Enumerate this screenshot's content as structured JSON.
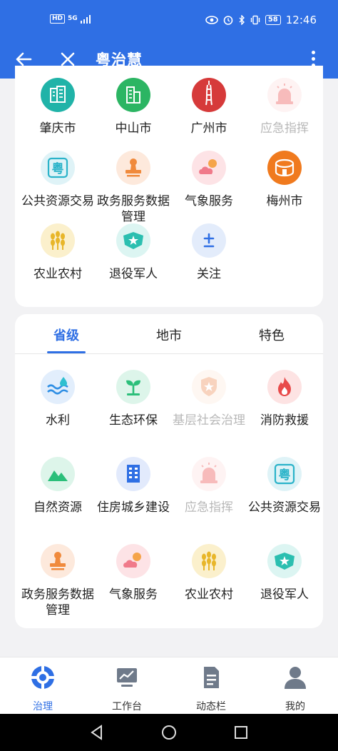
{
  "statusbar": {
    "left_badge": "HD",
    "network": "5G",
    "battery": "58",
    "time": "12:46"
  },
  "appbar": {
    "title": "粤治慧"
  },
  "top_card": {
    "items": [
      {
        "label": "肇庆市",
        "icon": "building-icon",
        "color": "#20b3a8",
        "disabled": false
      },
      {
        "label": "中山市",
        "icon": "tower-building-icon",
        "color": "#2cb563",
        "disabled": false
      },
      {
        "label": "广州市",
        "icon": "canton-tower-icon",
        "color": "#d63a3a",
        "disabled": false
      },
      {
        "label": "应急指挥",
        "icon": "siren-icon",
        "color": "#ef6a6a",
        "disabled": true
      },
      {
        "label": "公共资源交易",
        "icon": "yue-badge-icon",
        "color": "#2bb3c9",
        "disabled": false
      },
      {
        "label": "政务服务数据管理",
        "icon": "stamp-icon",
        "color": "#f08a3c",
        "disabled": false
      },
      {
        "label": "气象服务",
        "icon": "weather-icon",
        "color": "#f07a8a",
        "disabled": false
      },
      {
        "label": "梅州市",
        "icon": "tulou-icon",
        "color": "#f07a1e",
        "disabled": false
      },
      {
        "label": "农业农村",
        "icon": "wheat-icon",
        "color": "#e8b62a",
        "disabled": false
      },
      {
        "label": "退役军人",
        "icon": "military-badge-icon",
        "color": "#2bbfb0",
        "disabled": false
      },
      {
        "label": "关注",
        "icon": "plus-minus-icon",
        "color": "#2f6fe4",
        "disabled": false
      }
    ]
  },
  "tabs": [
    {
      "label": "省级",
      "active": true
    },
    {
      "label": "地市",
      "active": false
    },
    {
      "label": "特色",
      "active": false
    }
  ],
  "bottom_card": {
    "items": [
      {
        "label": "水利",
        "icon": "water-icon",
        "color": "#2f8fe4",
        "disabled": false
      },
      {
        "label": "生态环保",
        "icon": "sprout-icon",
        "color": "#2bbf7a",
        "disabled": false
      },
      {
        "label": "基层社会治理",
        "icon": "shield-star-icon",
        "color": "#f0a070",
        "disabled": true
      },
      {
        "label": "消防救援",
        "icon": "fire-icon",
        "color": "#e84a4a",
        "disabled": false
      },
      {
        "label": "自然资源",
        "icon": "mountain-icon",
        "color": "#2bbf7a",
        "disabled": false
      },
      {
        "label": "住房城乡建设",
        "icon": "apartment-icon",
        "color": "#2f6fe4",
        "disabled": false
      },
      {
        "label": "应急指挥",
        "icon": "siren-icon",
        "color": "#ef6a6a",
        "disabled": true
      },
      {
        "label": "公共资源交易",
        "icon": "yue-badge-icon",
        "color": "#2bb3c9",
        "disabled": false
      },
      {
        "label": "政务服务数据管理",
        "icon": "stamp-icon",
        "color": "#f08a3c",
        "disabled": false
      },
      {
        "label": "气象服务",
        "icon": "weather-icon",
        "color": "#f07a8a",
        "disabled": false
      },
      {
        "label": "农业农村",
        "icon": "wheat-icon",
        "color": "#e8b62a",
        "disabled": false
      },
      {
        "label": "退役军人",
        "icon": "military-badge-icon",
        "color": "#2bbfb0",
        "disabled": false
      }
    ]
  },
  "bottomnav": [
    {
      "label": "治理",
      "icon": "governance-icon",
      "active": true
    },
    {
      "label": "工作台",
      "icon": "dashboard-icon",
      "active": false
    },
    {
      "label": "动态栏",
      "icon": "document-icon",
      "active": false
    },
    {
      "label": "我的",
      "icon": "person-icon",
      "active": false
    }
  ],
  "accent_color": "#2f6fe4"
}
